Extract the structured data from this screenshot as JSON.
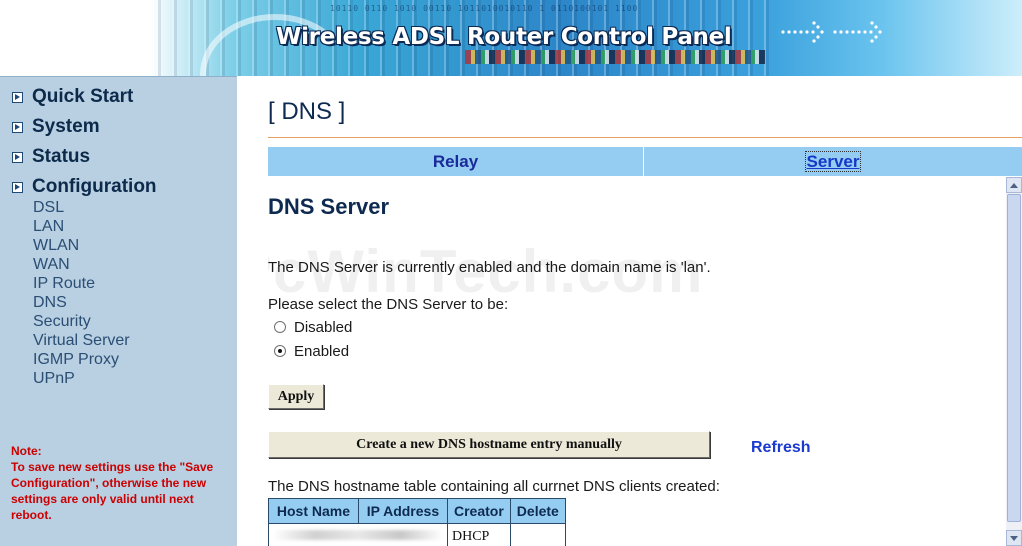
{
  "header": {
    "title": "Wireless ADSL Router Control Panel",
    "binary_text": "10110 0110 1010 00110 1011010010110 1 0110100101 1100",
    "arrow": "→"
  },
  "sidebar": {
    "nav": [
      {
        "label": "Quick Start"
      },
      {
        "label": "System"
      },
      {
        "label": "Status"
      },
      {
        "label": "Configuration"
      }
    ],
    "config_items": [
      "DSL",
      "LAN",
      "WLAN",
      "WAN",
      "IP Route",
      "DNS",
      "Security",
      "Virtual Server",
      "IGMP Proxy",
      "UPnP"
    ],
    "note_label": "Note:",
    "note_text": "To save new settings use the \"Save Configuration\", otherwise the new settings are only valid until next reboot."
  },
  "main": {
    "page_title": "[ DNS ]",
    "tabs": [
      {
        "label": "Relay",
        "active": false
      },
      {
        "label": "Server",
        "active": true
      }
    ],
    "section_title": "DNS Server",
    "watermark": "PcWinTech.com",
    "status_text": "The DNS Server is currently enabled and the domain name is 'lan'.",
    "select_prompt": "Please select the DNS Server to be:",
    "options": [
      {
        "label": "Disabled",
        "checked": false
      },
      {
        "label": "Enabled",
        "checked": true
      }
    ],
    "apply_label": "Apply",
    "create_label": "Create a new DNS hostname entry manually",
    "refresh_label": "Refresh",
    "table_caption": "The DNS hostname table containing all currnet DNS clients created:",
    "table": {
      "columns": [
        "Host Name",
        "IP Address",
        "Creator",
        "Delete"
      ],
      "rows": [
        {
          "host_name": "",
          "ip_address": "",
          "creator": "DHCP",
          "delete": ""
        }
      ]
    }
  },
  "colors": {
    "sidebar_bg": "#b9cfe2",
    "tab_bg": "#95cdf2",
    "note_red": "#cc0000",
    "link_blue": "#1a3ad0"
  }
}
